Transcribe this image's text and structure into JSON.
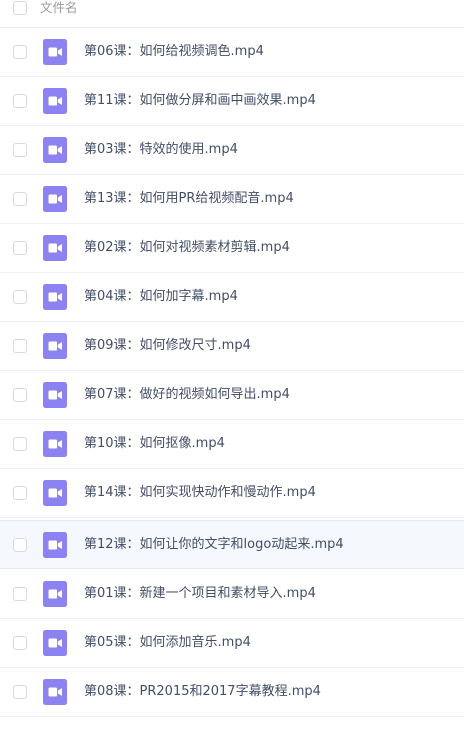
{
  "header": {
    "column_label": "文件名"
  },
  "files": [
    {
      "name": "第06课：如何给视频调色.mp4",
      "icon": "video-file-icon"
    },
    {
      "name": "第11课：如何做分屏和画中画效果.mp4",
      "icon": "video-file-icon"
    },
    {
      "name": "第03课：特效的使用.mp4",
      "icon": "video-file-icon"
    },
    {
      "name": "第13课：如何用PR给视频配音.mp4",
      "icon": "video-file-icon"
    },
    {
      "name": "第02课：如何对视频素材剪辑.mp4",
      "icon": "video-file-icon"
    },
    {
      "name": "第04课：如何加字幕.mp4",
      "icon": "video-file-icon"
    },
    {
      "name": "第09课：如何修改尺寸.mp4",
      "icon": "video-file-icon"
    },
    {
      "name": "第07课：做好的视频如何导出.mp4",
      "icon": "video-file-icon"
    },
    {
      "name": "第10课：如何抠像.mp4",
      "icon": "video-file-icon"
    },
    {
      "name": "第14课：如何实现快动作和慢动作.mp4",
      "icon": "video-file-icon"
    },
    {
      "name": "第12课：如何让你的文字和logo动起来.mp4",
      "icon": "video-file-icon"
    },
    {
      "name": "第01课：新建一个项目和素材导入.mp4",
      "icon": "video-file-icon"
    },
    {
      "name": "第05课：如何添加音乐.mp4",
      "icon": "video-file-icon"
    },
    {
      "name": "第08课：PR2015和2017字幕教程.mp4",
      "icon": "video-file-icon"
    }
  ],
  "colors": {
    "icon_purple": "#8c82f2",
    "text": "#424e67",
    "hover_row": "#f5f8fd"
  }
}
